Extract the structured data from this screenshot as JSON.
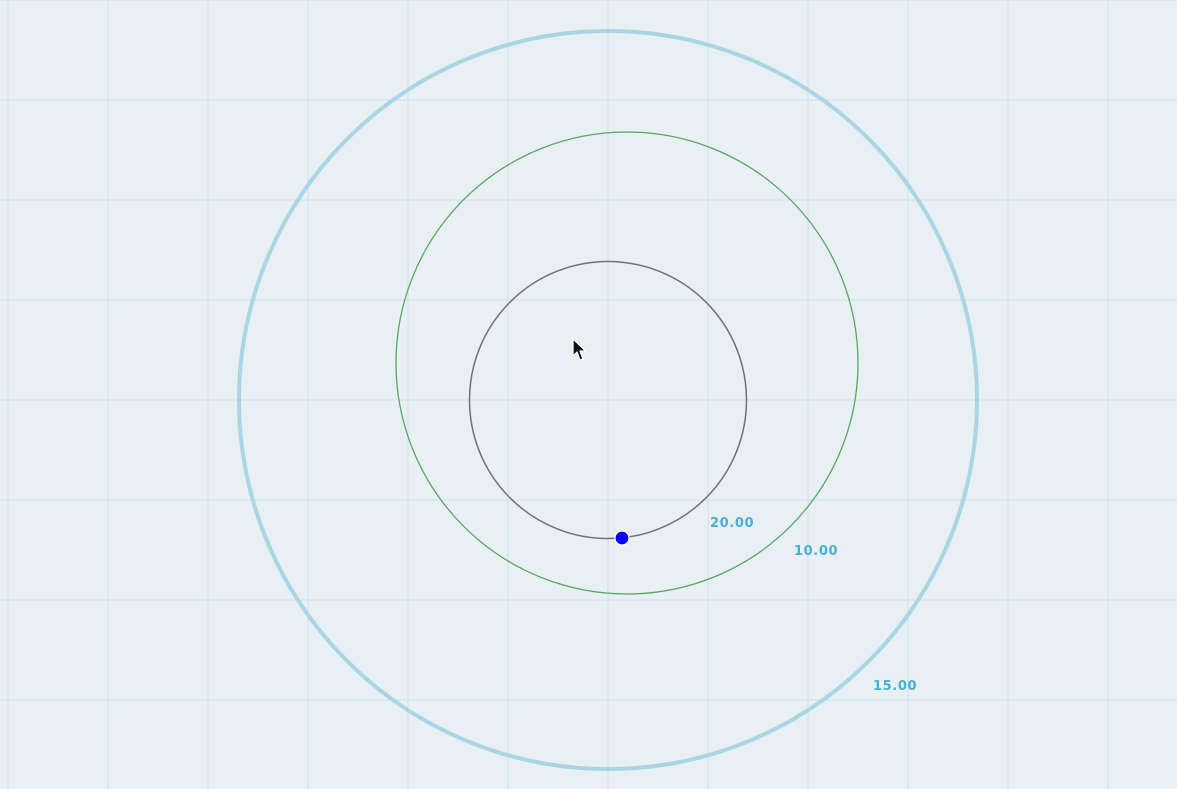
{
  "colors": {
    "background": "#e8f0f4",
    "grid": "#d6e0f2",
    "outer_circle": "#a9d5e4",
    "middle_circle": "#5aa85f",
    "inner_circle": "#6e7277",
    "point": "#0000ff",
    "dimension_label": "#4aaed6"
  },
  "icons": {
    "cursor": "mouse-pointer-arrow-icon"
  },
  "dimensions": {
    "inner": "20.00",
    "middle": "10.00",
    "outer": "15.00"
  }
}
